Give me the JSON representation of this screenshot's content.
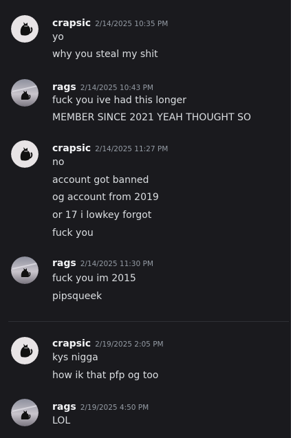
{
  "messages": [
    {
      "username": "crapsic",
      "timestamp": "2/14/2025 10:35 PM",
      "avatar": "cat-avatar-icon",
      "lines": [
        "yo",
        "why you steal my shit"
      ]
    },
    {
      "username": "rags",
      "timestamp": "2/14/2025 10:43 PM",
      "avatar": "cat-on-sky-avatar-icon",
      "lines": [
        "fuck you ive had this longer",
        "MEMBER SINCE 2021 YEAH THOUGHT SO"
      ]
    },
    {
      "username": "crapsic",
      "timestamp": "2/14/2025 11:27 PM",
      "avatar": "cat-avatar-icon",
      "lines": [
        "no",
        "account got banned",
        "og account from 2019",
        "or 17 i lowkey forgot",
        "fuck you"
      ]
    },
    {
      "username": "rags",
      "timestamp": "2/14/2025 11:30 PM",
      "avatar": "cat-on-sky-avatar-icon",
      "lines": [
        "fuck you im 2015",
        "pipsqueek"
      ]
    },
    {
      "username": "crapsic",
      "timestamp": "2/19/2025 2:05 PM",
      "avatar": "cat-avatar-icon",
      "lines": [
        "kys nigga",
        "how ik that pfp og too"
      ]
    },
    {
      "username": "rags",
      "timestamp": "2/19/2025 4:50 PM",
      "avatar": "cat-on-sky-avatar-icon",
      "lines": [
        "LOL"
      ]
    }
  ],
  "colors": {
    "background": "#1a1a1e",
    "username": "#f2f3f5",
    "timestamp": "#949ba4",
    "message_text": "#dbdee1",
    "divider": "#2e3035"
  }
}
